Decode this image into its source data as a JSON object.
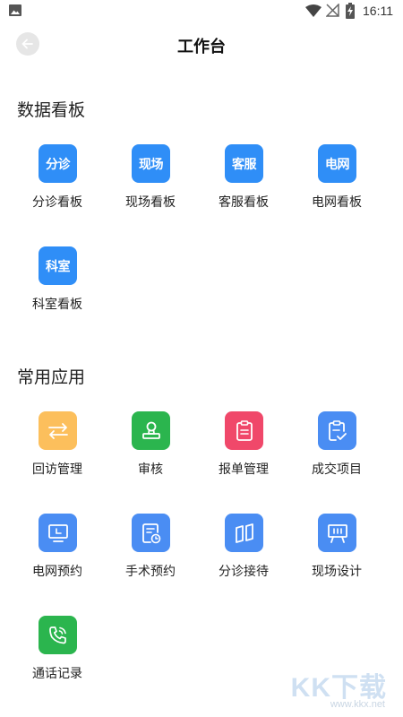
{
  "status_bar": {
    "time": "16:11"
  },
  "header": {
    "title": "工作台"
  },
  "sections": {
    "dashboards": {
      "title": "数据看板",
      "items": [
        {
          "label": "分诊看板",
          "icon_text": "分诊",
          "color": "#2f8ef7"
        },
        {
          "label": "现场看板",
          "icon_text": "现场",
          "color": "#2f8ef7"
        },
        {
          "label": "客服看板",
          "icon_text": "客服",
          "color": "#2f8ef7"
        },
        {
          "label": "电网看板",
          "icon_text": "电网",
          "color": "#2f8ef7"
        },
        {
          "label": "科室看板",
          "icon_text": "科室",
          "color": "#2f8ef7"
        }
      ]
    },
    "apps": {
      "title": "常用应用",
      "items": [
        {
          "label": "回访管理",
          "icon": "swap-arrows-icon",
          "color": "#fcbf5c"
        },
        {
          "label": "审核",
          "icon": "stamp-icon",
          "color": "#2bb54e"
        },
        {
          "label": "报单管理",
          "icon": "clipboard-icon",
          "color": "#f0486a"
        },
        {
          "label": "成交项目",
          "icon": "clipboard-check-icon",
          "color": "#4a8df3"
        },
        {
          "label": "电网预约",
          "icon": "monitor-icon",
          "color": "#4a8df3"
        },
        {
          "label": "手术预约",
          "icon": "document-clock-icon",
          "color": "#4a8df3"
        },
        {
          "label": "分诊接待",
          "icon": "map-panels-icon",
          "color": "#4a8df3"
        },
        {
          "label": "现场设计",
          "icon": "easel-icon",
          "color": "#4a8df3"
        },
        {
          "label": "通话记录",
          "icon": "phone-icon",
          "color": "#2bb54e"
        }
      ]
    }
  },
  "watermark": {
    "logo": "KK下载",
    "url": "www.kkx.net"
  }
}
